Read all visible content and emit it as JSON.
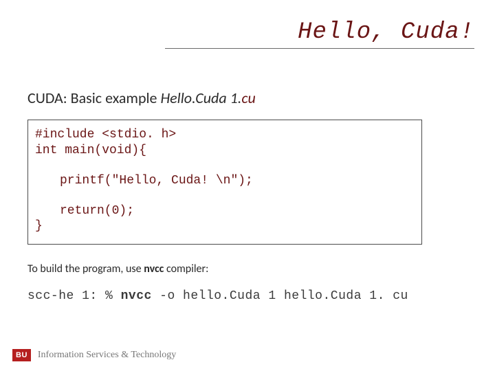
{
  "slide": {
    "title": "Hello, Cuda!",
    "subtitle_lead": "CUDA: Basic example  ",
    "subtitle_file_base": "Hello.Cuda 1.",
    "subtitle_file_ext": "cu",
    "code": {
      "line1": "#include <stdio. h>",
      "line2": "int main(void){",
      "line3": "printf(\"Hello, Cuda! \\n\");",
      "line4": "return(0);",
      "line5": "}"
    },
    "note_pre": "To build the program, use ",
    "note_comp": "nvcc",
    "note_post": " compiler:",
    "cmd_prefix": "scc-he 1: % ",
    "cmd_bin": "nvcc",
    "cmd_args": " -o hello.Cuda 1 hello.Cuda 1. cu",
    "footer": {
      "logo": "BU",
      "text": "Information Services & Technology"
    }
  }
}
